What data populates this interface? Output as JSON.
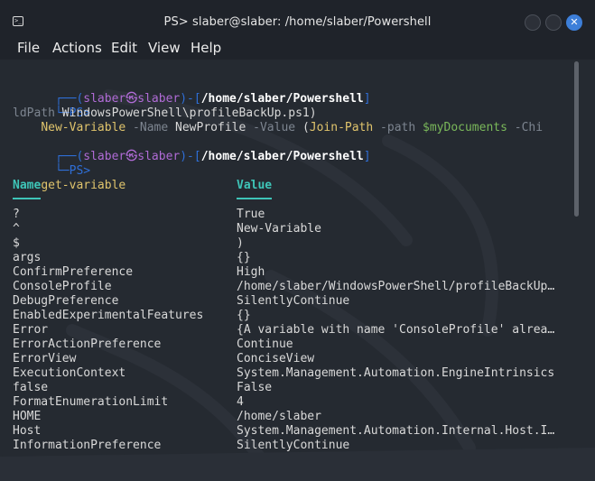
{
  "window": {
    "title": "PS> slaber@slaber: /home/slaber/Powershell"
  },
  "menu": [
    "File",
    "Actions",
    "Edit",
    "View",
    "Help"
  ],
  "prompt": {
    "open": "┌──(",
    "user": "slaber",
    "at": "㉿",
    "host": "slaber",
    "mid": ")-[",
    "path": "/home/slaber/Powershell",
    "close": "]",
    "ps": "└─PS>"
  },
  "commands": [
    {
      "parts": [
        {
          "t": "New-Variable",
          "c": "cmd"
        },
        {
          "t": " -Name ",
          "c": "param"
        },
        {
          "t": "NewProfile",
          "c": "plain"
        },
        {
          "t": " -Value ",
          "c": "param"
        },
        {
          "t": "(",
          "c": "plain"
        },
        {
          "t": "Join-Path",
          "c": "cmd"
        },
        {
          "t": " -path ",
          "c": "param"
        },
        {
          "t": "$myDocuments",
          "c": "var"
        },
        {
          "t": " -Chi",
          "c": "param"
        }
      ],
      "wrap": [
        {
          "t": "ldPath",
          "c": "param"
        },
        {
          "t": " WindowsPowerShell\\profileBackUp.ps1)",
          "c": "plain"
        }
      ]
    },
    {
      "parts": [
        {
          "t": "get-variable",
          "c": "cmd"
        }
      ]
    }
  ],
  "table": {
    "headers": [
      "Name",
      "Value"
    ],
    "rows": [
      {
        "name": "?",
        "value": "True"
      },
      {
        "name": "^",
        "value": "New-Variable"
      },
      {
        "name": "$",
        "value": ")"
      },
      {
        "name": "args",
        "value": "{}"
      },
      {
        "name": "ConfirmPreference",
        "value": "High"
      },
      {
        "name": "ConsoleProfile",
        "value": "/home/slaber/WindowsPowerShell/profileBackUp…"
      },
      {
        "name": "DebugPreference",
        "value": "SilentlyContinue"
      },
      {
        "name": "EnabledExperimentalFeatures",
        "value": "{}"
      },
      {
        "name": "Error",
        "value": "{A variable with name 'ConsoleProfile' alrea…"
      },
      {
        "name": "ErrorActionPreference",
        "value": "Continue"
      },
      {
        "name": "ErrorView",
        "value": "ConciseView"
      },
      {
        "name": "ExecutionContext",
        "value": "System.Management.Automation.EngineIntrinsics"
      },
      {
        "name": "false",
        "value": "False"
      },
      {
        "name": "FormatEnumerationLimit",
        "value": "4"
      },
      {
        "name": "HOME",
        "value": "/home/slaber"
      },
      {
        "name": "Host",
        "value": "System.Management.Automation.Internal.Host.I…"
      },
      {
        "name": "InformationPreference",
        "value": "SilentlyContinue"
      }
    ]
  },
  "colors": {
    "background": "#252a31",
    "prompt_blue": "#2f6fd8",
    "prompt_user": "#b06bd6",
    "command": "#e0c46c",
    "parameter": "#7d8590",
    "variable": "#7ab85a",
    "header": "#3ec5b8",
    "close_button": "#3d7fd9"
  },
  "icons": {
    "app": "terminal-icon",
    "minimize": "minimize-icon",
    "maximize": "maximize-icon",
    "close": "close-icon"
  }
}
